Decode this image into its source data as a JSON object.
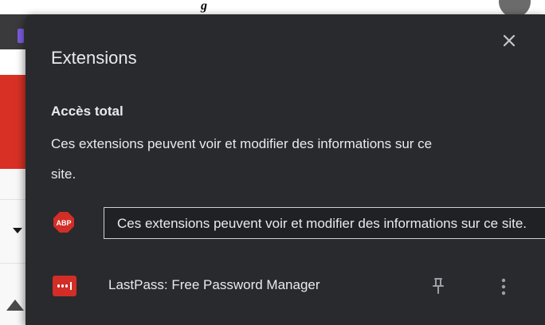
{
  "background": {
    "title_fragment": "g"
  },
  "popup": {
    "title": "Extensions",
    "close_icon": "close-icon",
    "section": {
      "heading": "Accès total",
      "description": "Ces extensions peuvent voir et modifier des informations sur ce site."
    },
    "extensions": [
      {
        "icon": "abp-icon",
        "icon_text": "ABP",
        "tooltip": "Ces extensions peuvent voir et modifier des informations sur ce site."
      },
      {
        "icon": "lastpass-icon",
        "name": "LastPass: Free Password Manager",
        "pin_icon": "pin-icon",
        "more_icon": "more-vertical-icon"
      }
    ]
  },
  "colors": {
    "popup_bg": "#292a2d",
    "text": "#e8eaed",
    "abp_red": "#d32d27",
    "lastpass_red": "#d32d27",
    "page_red_band": "#d93025"
  }
}
